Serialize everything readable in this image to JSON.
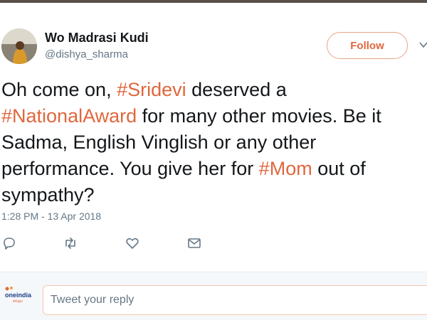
{
  "user": {
    "display_name": "Wo Madrasi Kudi",
    "handle": "@dishya_sharma"
  },
  "follow_label": "Follow",
  "tweet": {
    "segments": [
      {
        "text": "Oh come on, ",
        "hashtag": false
      },
      {
        "text": "#Sridevi",
        "hashtag": true
      },
      {
        "text": " deserved a ",
        "hashtag": false
      },
      {
        "text": "#NationalAward",
        "hashtag": true
      },
      {
        "text": " for many other movies. Be it Sadma, English Vinglish or any other performance. You give her for ",
        "hashtag": false
      },
      {
        "text": "#Mom",
        "hashtag": true
      },
      {
        "text": " out of sympathy?",
        "hashtag": false
      }
    ],
    "timestamp": "1:28 PM - 13 Apr 2018"
  },
  "actions": [
    {
      "name": "reply-icon"
    },
    {
      "name": "retweet-icon"
    },
    {
      "name": "like-icon"
    },
    {
      "name": "direct-message-icon"
    }
  ],
  "reply": {
    "placeholder": "Tweet your reply"
  },
  "brand": {
    "name": "oneindia",
    "sub": "telugu"
  },
  "colors": {
    "accent": "#e0673d",
    "text": "#14171a",
    "secondary": "#657786"
  }
}
